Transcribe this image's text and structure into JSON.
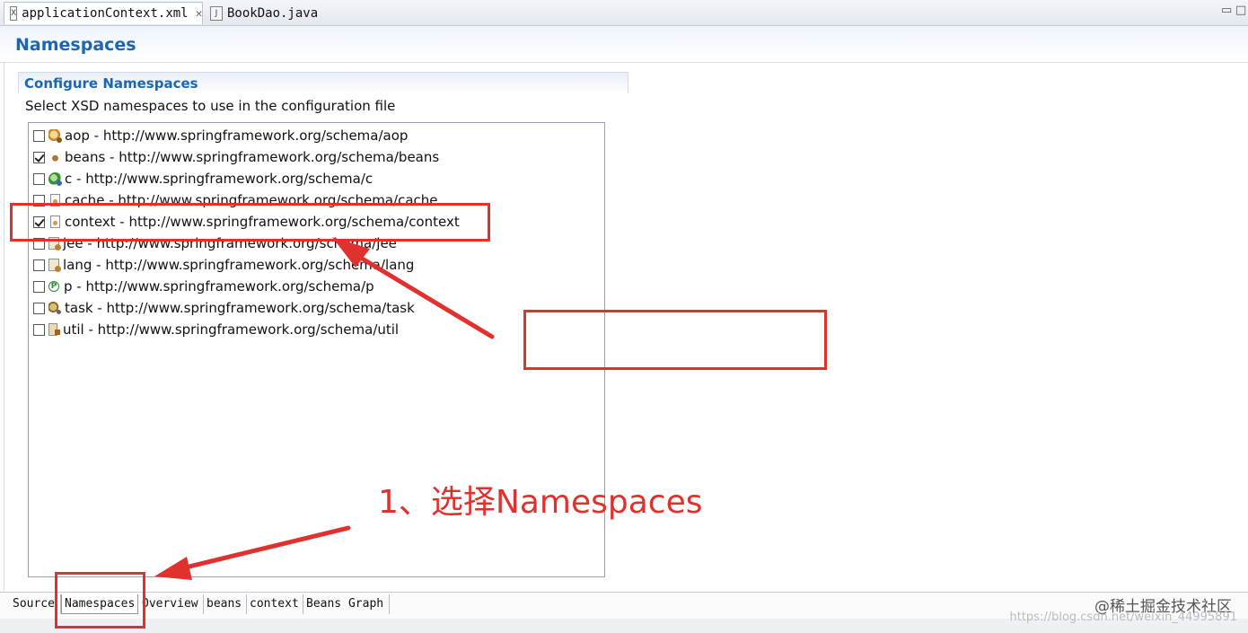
{
  "editor_tabs": [
    {
      "label": "applicationContext.xml",
      "active": true,
      "icon": "xml-file-icon",
      "closable": true
    },
    {
      "label": "BookDao.java",
      "active": false,
      "icon": "java-file-icon",
      "closable": false
    }
  ],
  "window_controls": {
    "minimize": "▭",
    "maximize": "□"
  },
  "page": {
    "title": "Namespaces",
    "section_title": "Configure Namespaces",
    "description": "Select XSD namespaces to use in the configuration file"
  },
  "namespaces": [
    {
      "label": "aop - http://www.springframework.org/schema/aop",
      "checked": false,
      "icon": "aop-icon"
    },
    {
      "label": "beans - http://www.springframework.org/schema/beans",
      "checked": true,
      "icon": "beans-icon"
    },
    {
      "label": "c - http://www.springframework.org/schema/c",
      "checked": false,
      "icon": "c-icon"
    },
    {
      "label": "cache - http://www.springframework.org/schema/cache",
      "checked": false,
      "icon": "cache-icon"
    },
    {
      "label": "context - http://www.springframework.org/schema/context",
      "checked": true,
      "icon": "context-icon"
    },
    {
      "label": "jee - http://www.springframework.org/schema/jee",
      "checked": false,
      "icon": "jee-icon"
    },
    {
      "label": "lang - http://www.springframework.org/schema/lang",
      "checked": false,
      "icon": "lang-icon"
    },
    {
      "label": "p - http://www.springframework.org/schema/p",
      "checked": false,
      "icon": "p-icon"
    },
    {
      "label": "task - http://www.springframework.org/schema/task",
      "checked": false,
      "icon": "task-icon"
    },
    {
      "label": "util - http://www.springframework.org/schema/util",
      "checked": false,
      "icon": "util-icon"
    }
  ],
  "bottom_tabs": [
    {
      "label": "Source",
      "active": false
    },
    {
      "label": "Namespaces",
      "active": true
    },
    {
      "label": "Overview",
      "active": false
    },
    {
      "label": "beans",
      "active": false
    },
    {
      "label": "context",
      "active": false
    },
    {
      "label": "Beans Graph",
      "active": false
    }
  ],
  "annotation": {
    "text": "1、选择Namespaces",
    "color": "#e0312f"
  },
  "watermark": {
    "text": "@稀土掘金技术社区",
    "url": "https://blog.csdn.net/weixin_44995891"
  },
  "colors": {
    "title_blue": "#1d66b1",
    "annotation_red": "#e0312f"
  }
}
